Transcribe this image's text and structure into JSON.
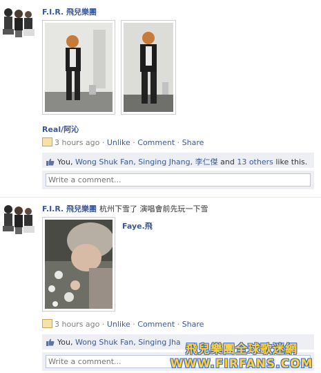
{
  "posts": [
    {
      "author": "F.I.R. 飛兒樂團",
      "status": "",
      "caption": "Real/阿沁",
      "time": "3 hours ago",
      "actions": {
        "unlike": "Unlike",
        "comment": "Comment",
        "share": "Share"
      },
      "likes": {
        "you": "You,",
        "names": [
          "Wong Shuk Fan,",
          "Singing Jhang,",
          "李仁傑"
        ],
        "and": "and",
        "others": "13 others",
        "suffix": "like this."
      },
      "comment_placeholder": "Write a comment..."
    },
    {
      "author": "F.I.R. 飛兒樂團",
      "status": "杭州下雪了 演唱會前先玩一下雪",
      "caption": "Faye.飛",
      "time": "3 hours ago",
      "actions": {
        "unlike": "Unlike",
        "comment": "Comment",
        "share": "Share"
      },
      "likes": {
        "you": "You,",
        "names": [
          "Wong Shuk Fan,",
          "Singing Jha"
        ]
      },
      "comment_placeholder": "Write a comment..."
    }
  ],
  "watermark": {
    "line1": "飛兒樂團全球歌迷網",
    "line2": "WWW.FIRFANS.COM"
  },
  "colors": {
    "link": "#3b5998",
    "meta": "#808080",
    "like_bg": "#edeff4",
    "watermark": "#ffd23a"
  }
}
